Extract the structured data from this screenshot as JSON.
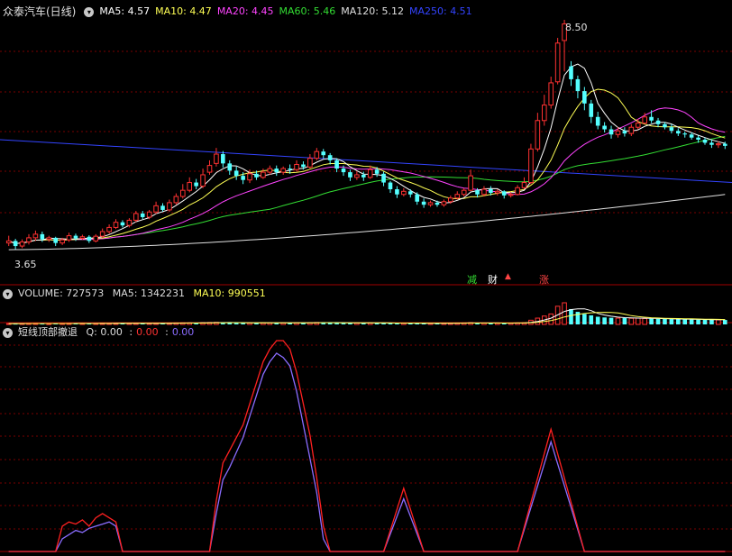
{
  "colors": {
    "bg": "#000000",
    "grid": "#7a0000",
    "up": "#ff3232",
    "down": "#54ffff",
    "ma5": "#ffffff",
    "ma10": "#ffff55",
    "ma20": "#ff44ff",
    "ma60": "#33dd33",
    "ma120": "#e0e0e0",
    "ma250": "#3344ff",
    "ind_red": "#ff2020",
    "ind_purple": "#8a6cff"
  },
  "main_panel": {
    "title": "众泰汽车(日线)",
    "collapse_icon": "chevron-down-icon",
    "ma": [
      {
        "label": "MA5: ",
        "value": "4.57",
        "color": "#ffffff"
      },
      {
        "label": "MA10: ",
        "value": "4.47",
        "color": "#ffff55"
      },
      {
        "label": "MA20: ",
        "value": "4.45",
        "color": "#ff44ff"
      },
      {
        "label": "MA60: ",
        "value": "5.46",
        "color": "#33dd33"
      },
      {
        "label": "MA120: ",
        "value": "5.12",
        "color": "#e0e0e0"
      },
      {
        "label": "MA250: ",
        "value": "4.51",
        "color": "#3344ff"
      }
    ],
    "high_label": "8.50",
    "low_label": "3.65",
    "event_markers": [
      {
        "text": "减",
        "color": "#33dd33"
      },
      {
        "text": "财",
        "color": "#ffffff"
      },
      {
        "text": "涨",
        "color": "#ff4444"
      }
    ]
  },
  "volume_panel": {
    "label": "VOLUME: ",
    "value": "727573",
    "ma5_label": "MA5: ",
    "ma5_value": "1342231",
    "ma10_label": "MA10: ",
    "ma10_value": "990551"
  },
  "indicator_panel": {
    "name": "短线顶部撤退",
    "q_label": "Q: ",
    "q_value": "0.00",
    "v2": "0.00",
    "v3": "0.00",
    "sep": ":"
  },
  "chart_data": {
    "type": "candlestick",
    "y_min": 3.65,
    "y_max": 8.5,
    "candles": [
      [
        4.18,
        4.22,
        4.32,
        4.12
      ],
      [
        4.22,
        4.12,
        4.26,
        4.06
      ],
      [
        4.12,
        4.2,
        4.25,
        4.08
      ],
      [
        4.2,
        4.28,
        4.35,
        4.15
      ],
      [
        4.28,
        4.35,
        4.42,
        4.22
      ],
      [
        4.35,
        4.25,
        4.4,
        4.2
      ],
      [
        4.25,
        4.28,
        4.32,
        4.2
      ],
      [
        4.28,
        4.18,
        4.3,
        4.12
      ],
      [
        4.18,
        4.24,
        4.28,
        4.14
      ],
      [
        4.24,
        4.32,
        4.38,
        4.2
      ],
      [
        4.32,
        4.27,
        4.36,
        4.22
      ],
      [
        4.27,
        4.3,
        4.34,
        4.24
      ],
      [
        4.3,
        4.22,
        4.33,
        4.18
      ],
      [
        4.22,
        4.31,
        4.35,
        4.19
      ],
      [
        4.31,
        4.4,
        4.46,
        4.28
      ],
      [
        4.4,
        4.48,
        4.54,
        4.36
      ],
      [
        4.48,
        4.58,
        4.64,
        4.45
      ],
      [
        4.58,
        4.52,
        4.62,
        4.48
      ],
      [
        4.52,
        4.62,
        4.66,
        4.48
      ],
      [
        4.62,
        4.75,
        4.8,
        4.58
      ],
      [
        4.75,
        4.68,
        4.8,
        4.64
      ],
      [
        4.68,
        4.78,
        4.82,
        4.64
      ],
      [
        4.78,
        4.9,
        4.98,
        4.74
      ],
      [
        4.9,
        4.82,
        4.95,
        4.78
      ],
      [
        4.82,
        4.96,
        5.02,
        4.78
      ],
      [
        4.96,
        5.08,
        5.14,
        4.92
      ],
      [
        5.08,
        5.2,
        5.32,
        5.04
      ],
      [
        5.2,
        5.35,
        5.45,
        5.16
      ],
      [
        5.35,
        5.28,
        5.42,
        5.22
      ],
      [
        5.28,
        5.5,
        5.62,
        5.24
      ],
      [
        5.55,
        5.68,
        5.78,
        5.5
      ],
      [
        5.72,
        5.9,
        6.02,
        5.66
      ],
      [
        5.9,
        5.72,
        5.96,
        5.64
      ],
      [
        5.72,
        5.58,
        5.78,
        5.5
      ],
      [
        5.58,
        5.48,
        5.66,
        5.4
      ],
      [
        5.48,
        5.4,
        5.55,
        5.32
      ],
      [
        5.4,
        5.52,
        5.6,
        5.34
      ],
      [
        5.52,
        5.45,
        5.58,
        5.4
      ],
      [
        5.45,
        5.55,
        5.62,
        5.42
      ],
      [
        5.55,
        5.62,
        5.68,
        5.5
      ],
      [
        5.62,
        5.55,
        5.68,
        5.48
      ],
      [
        5.55,
        5.62,
        5.66,
        5.5
      ],
      [
        5.62,
        5.6,
        5.7,
        5.52
      ],
      [
        5.6,
        5.7,
        5.78,
        5.56
      ],
      [
        5.7,
        5.65,
        5.76,
        5.6
      ],
      [
        5.65,
        5.82,
        5.9,
        5.62
      ],
      [
        5.82,
        5.95,
        6.02,
        5.78
      ],
      [
        5.95,
        5.88,
        6.0,
        5.82
      ],
      [
        5.88,
        5.78,
        5.92,
        5.7
      ],
      [
        5.78,
        5.62,
        5.82,
        5.55
      ],
      [
        5.62,
        5.55,
        5.68,
        5.48
      ],
      [
        5.55,
        5.45,
        5.6,
        5.38
      ],
      [
        5.45,
        5.5,
        5.56,
        5.4
      ],
      [
        5.5,
        5.45,
        5.56,
        5.38
      ],
      [
        5.45,
        5.6,
        5.68,
        5.42
      ],
      [
        5.6,
        5.52,
        5.65,
        5.46
      ],
      [
        5.52,
        5.35,
        5.56,
        5.28
      ],
      [
        5.35,
        5.22,
        5.38,
        5.15
      ],
      [
        5.22,
        5.12,
        5.28,
        5.05
      ],
      [
        5.12,
        5.18,
        5.24,
        5.08
      ],
      [
        5.18,
        5.12,
        5.22,
        5.06
      ],
      [
        5.12,
        4.98,
        5.16,
        4.92
      ],
      [
        4.98,
        4.92,
        5.04,
        4.86
      ],
      [
        4.92,
        4.96,
        5.0,
        4.88
      ],
      [
        4.96,
        4.92,
        5.0,
        4.88
      ],
      [
        4.92,
        4.98,
        5.02,
        4.88
      ],
      [
        4.98,
        5.05,
        5.1,
        4.94
      ],
      [
        5.05,
        5.12,
        5.18,
        5.02
      ],
      [
        5.12,
        5.2,
        5.24,
        5.08
      ],
      [
        5.2,
        5.48,
        5.6,
        5.18
      ],
      [
        5.2,
        5.12,
        5.24,
        5.06
      ],
      [
        5.12,
        5.22,
        5.28,
        5.08
      ],
      [
        5.22,
        5.15,
        5.28,
        5.1
      ],
      [
        5.15,
        5.18,
        5.22,
        5.1
      ],
      [
        5.18,
        5.1,
        5.2,
        5.04
      ],
      [
        5.1,
        5.12,
        5.16,
        5.06
      ],
      [
        5.12,
        5.25,
        5.3,
        5.1
      ],
      [
        5.25,
        5.35,
        5.45,
        5.22
      ],
      [
        5.35,
        6.0,
        6.1,
        5.32
      ],
      [
        6.0,
        6.55,
        6.7,
        5.95
      ],
      [
        6.55,
        6.85,
        7.05,
        6.45
      ],
      [
        6.85,
        7.28,
        7.4,
        6.78
      ],
      [
        7.3,
        8.05,
        8.15,
        7.25
      ],
      [
        8.1,
        8.42,
        8.5,
        7.5
      ],
      [
        7.6,
        7.35,
        7.7,
        7.22
      ],
      [
        7.35,
        7.12,
        7.42,
        6.98
      ],
      [
        7.12,
        6.88,
        7.2,
        6.75
      ],
      [
        6.88,
        6.62,
        6.95,
        6.5
      ],
      [
        6.62,
        6.45,
        6.72,
        6.38
      ],
      [
        6.45,
        6.38,
        6.52,
        6.32
      ],
      [
        6.38,
        6.28,
        6.45,
        6.2
      ],
      [
        6.28,
        6.35,
        6.42,
        6.22
      ],
      [
        6.35,
        6.3,
        6.42,
        6.24
      ],
      [
        6.3,
        6.42,
        6.48,
        6.25
      ],
      [
        6.42,
        6.5,
        6.58,
        6.38
      ],
      [
        6.5,
        6.62,
        6.7,
        6.48
      ],
      [
        6.62,
        6.55,
        6.75,
        6.5
      ],
      [
        6.55,
        6.48,
        6.6,
        6.42
      ],
      [
        6.48,
        6.42,
        6.52,
        6.38
      ],
      [
        6.42,
        6.35,
        6.48,
        6.3
      ],
      [
        6.35,
        6.3,
        6.4,
        6.25
      ],
      [
        6.3,
        6.28,
        6.34,
        6.22
      ],
      [
        6.28,
        6.22,
        6.32,
        6.18
      ],
      [
        6.22,
        6.18,
        6.26,
        6.12
      ],
      [
        6.18,
        6.12,
        6.22,
        6.08
      ],
      [
        6.12,
        6.08,
        6.18,
        6.02
      ],
      [
        6.08,
        6.1,
        6.15,
        6.02
      ],
      [
        6.1,
        6.06,
        6.14,
        6.0
      ]
    ],
    "ma120_endpoints": [
      4.05,
      5.12
    ],
    "ma250_endpoints": [
      6.18,
      5.35
    ],
    "volume_max": 3200000,
    "volumes_bucketed": [
      120,
      110,
      130,
      140,
      150,
      120,
      110,
      130,
      140,
      160,
      150,
      130,
      120,
      140,
      170,
      150,
      180,
      160,
      170,
      190,
      160,
      170,
      180,
      160,
      200,
      210,
      230,
      220,
      200,
      260,
      280,
      300,
      260,
      230,
      210,
      200,
      220,
      210,
      230,
      240,
      220,
      210,
      230,
      240,
      220,
      260,
      280,
      260,
      240,
      220,
      200,
      190,
      210,
      200,
      230,
      210,
      190,
      180,
      170,
      180,
      190,
      170,
      160,
      170,
      160,
      180,
      190,
      200,
      210,
      260,
      200,
      190,
      200,
      180,
      170,
      190,
      210,
      240,
      600,
      900,
      1200,
      1500,
      2600,
      3100,
      2200,
      1800,
      1500,
      1300,
      1100,
      1000,
      950,
      900,
      920,
      880,
      900,
      850,
      820,
      800,
      780,
      760,
      740,
      720,
      700,
      690,
      680,
      660,
      650,
      640
    ],
    "indicator": {
      "y_max": 100,
      "red": [
        0,
        0,
        0,
        0,
        0,
        0,
        0,
        0,
        12,
        14,
        13,
        15,
        12,
        16,
        18,
        16,
        14,
        0,
        0,
        0,
        0,
        0,
        0,
        0,
        0,
        0,
        0,
        0,
        0,
        0,
        0,
        24,
        42,
        48,
        54,
        60,
        70,
        80,
        90,
        96,
        100,
        100,
        96,
        85,
        70,
        55,
        35,
        12,
        0,
        0,
        0,
        0,
        0,
        0,
        0,
        0,
        0,
        0,
        0,
        0,
        0,
        0,
        0,
        0,
        0,
        0,
        0,
        0,
        0,
        0,
        0,
        0,
        0,
        0,
        0,
        0,
        0,
        0,
        0,
        0,
        0,
        0,
        0,
        0,
        0,
        0,
        0,
        0,
        0,
        0,
        0,
        0,
        0,
        0,
        0,
        0,
        0,
        0,
        0,
        0,
        0,
        0,
        0,
        0,
        0,
        0,
        0,
        0
      ],
      "purple": [
        0,
        0,
        0,
        0,
        0,
        0,
        0,
        0,
        6,
        8,
        10,
        9,
        11,
        12,
        13,
        14,
        12,
        0,
        0,
        0,
        0,
        0,
        0,
        0,
        0,
        0,
        0,
        0,
        0,
        0,
        0,
        18,
        34,
        40,
        47,
        54,
        64,
        74,
        84,
        90,
        94,
        92,
        88,
        76,
        60,
        44,
        28,
        6,
        0,
        0,
        0,
        0,
        0,
        0,
        0,
        0,
        0,
        0,
        0,
        0,
        0,
        0,
        0,
        0,
        0,
        0,
        0,
        0,
        0,
        0,
        0,
        0,
        0,
        0,
        0,
        0,
        0,
        0,
        0,
        0,
        0,
        0,
        0,
        0,
        0,
        0,
        0,
        0,
        0,
        0,
        0,
        0,
        0,
        0,
        0,
        0,
        0,
        0,
        0,
        0,
        0,
        0,
        0,
        0,
        0,
        0,
        0,
        0
      ]
    }
  }
}
